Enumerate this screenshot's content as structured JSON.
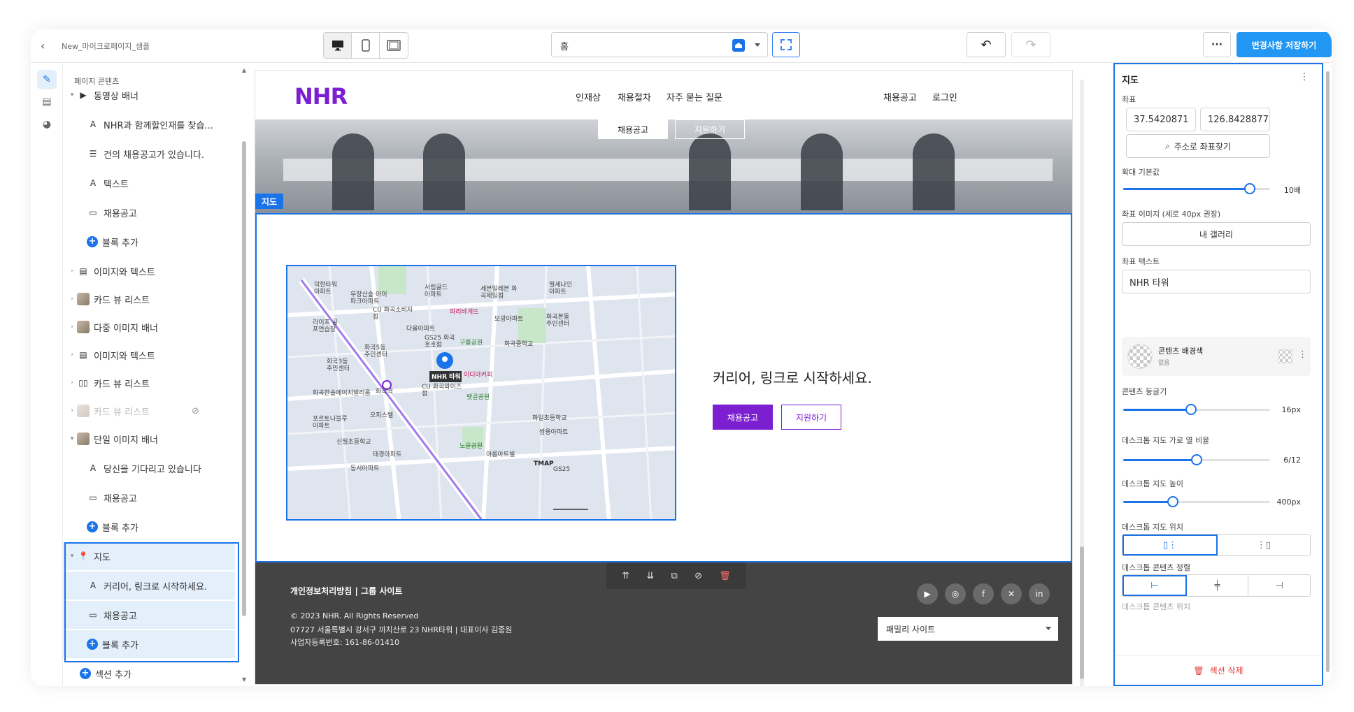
{
  "topbar": {
    "doc_title": "New_마이크로페이지_샘플",
    "page_select_value": "홈",
    "save_label": "변경사항 저장하기",
    "more_label": "···"
  },
  "layers": {
    "title": "페이지 콘텐츠",
    "items": [
      {
        "label": "동영상 배너"
      },
      {
        "label": "NHR과 함께할인재를 찾습..."
      },
      {
        "label": "건의 채용공고가 있습니다."
      },
      {
        "label": "텍스트"
      },
      {
        "label": "채용공고"
      },
      {
        "label": "블록 추가"
      },
      {
        "label": "이미지와 텍스트"
      },
      {
        "label": "카드 뷰 리스트"
      },
      {
        "label": "다중 이미지 배너"
      },
      {
        "label": "이미지와 텍스트"
      },
      {
        "label": "카드 뷰 리스트"
      },
      {
        "label": "카드 뷰 리스트"
      },
      {
        "label": "단일 이미지 배너"
      },
      {
        "label": "당신을 기다리고 있습니다"
      },
      {
        "label": "채용공고"
      },
      {
        "label": "블록 추가"
      },
      {
        "label": "지도"
      },
      {
        "label": "커리어, 링크로 시작하세요."
      },
      {
        "label": "채용공고"
      },
      {
        "label": "블록 추가"
      },
      {
        "label": "섹션 추가"
      }
    ]
  },
  "site": {
    "logo": "NHR",
    "nav": [
      "인재상",
      "채용절차",
      "자주 묻는 질문"
    ],
    "nav_right": [
      "채용공고",
      "로그인"
    ],
    "hero_btn_1": "채용공고",
    "hero_btn_2": "지원하기",
    "section_tag": "지도",
    "map_heading": "커리어, 링크로 시작하세요.",
    "btn_primary": "채용공고",
    "btn_outline": "지원하기",
    "map_pin_label": "NHR 타워",
    "map_labels": [
      "덕현타워 아파트",
      "우장산숲 아이파크아파트",
      "서림골드 아파트",
      "세븐일레븐 화곡제일점",
      "월세나인 아파트",
      "CU 화곡소비자점",
      "파리바게뜨",
      "보광아파트",
      "화곡본동 주민센터",
      "라이프 골프연습장",
      "다올아파트",
      "GS25 화곡호호점",
      "구름공원",
      "화곡중학교",
      "화곡5동 주민센터",
      "화곡3동 주민센터",
      "이디야커피",
      "화곡역",
      "화곡한솔에이치빌리움",
      "CU 화곡와이즈점",
      "뱃골공원",
      "오피스텔",
      "포르토나블루 아파트",
      "신월초등학교",
      "쌍용아파트",
      "화일초등학교",
      "노을공원",
      "태경아파트",
      "동서아파트",
      "아름아트빌",
      "TMAP",
      "GS25"
    ]
  },
  "footer": {
    "links": "개인정보처리방침   |   그룹 사이트",
    "copyright": "© 2023 NHR. All Rights Reserved",
    "address": "07727 서울특별시 강서구 까치산로 23 NHR타워 | 대표이사 김종원",
    "biz_no": "사업자등록번호: 161-86-01410",
    "family_site": "패밀리 사이트",
    "social": [
      "youtube-icon",
      "instagram-icon",
      "facebook-icon",
      "x-icon",
      "linkedin-icon"
    ]
  },
  "props": {
    "title": "지도",
    "coords_label": "좌표",
    "lat": "37.5420871",
    "lng": "126.8428877",
    "find_coords_btn": "주소로 좌표찾기",
    "zoom_label": "확대 기본값",
    "zoom_value": "10배",
    "zoom_fraction": 0.86,
    "marker_image_label": "좌표 이미지 (세로 40px 권장)",
    "gallery_btn": "내 갤러리",
    "marker_text_label": "좌표 텍스트",
    "marker_text_value": "NHR 타워",
    "bg_title": "콘텐츠 배경색",
    "bg_sub": "없음",
    "radius_label": "콘텐츠 둥글기",
    "radius_value": "16px",
    "radius_fraction": 0.46,
    "ratio_label": "데스크톱 지도 가로 열 비율",
    "ratio_value": "6/12",
    "ratio_fraction": 0.5,
    "height_label": "데스크톱 지도 높이",
    "height_value": "400px",
    "height_fraction": 0.34,
    "position_label": "데스크톱 지도 위치",
    "align_label": "데스크톱 콘텐츠 정렬",
    "cut_label": "데스크톱 콘텐츠 위치",
    "delete_label": "섹션 삭제"
  },
  "colors": {
    "accent": "#1a73e8",
    "brand": "#7b1fd1",
    "footer_bg": "#444444",
    "danger": "#e53935"
  }
}
